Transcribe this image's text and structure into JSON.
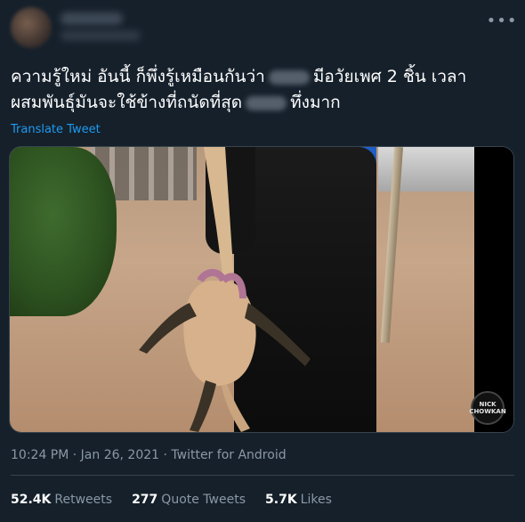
{
  "tweet": {
    "more_icon": "more-horizontal-icon",
    "text_line1_a": "ความรู้ใหม่ อันนี้ ก็พึ่งรู้เหมือนกันว่า",
    "text_line1_b": "มีอวัยเพศ 2 ชิ้น เวลา",
    "text_line2_a": "ผสมพันธุ์มันจะใช้ข้างที่ถนัดที่สุด",
    "text_line2_b": "ทึ่งมาก",
    "translate_label": "Translate Tweet",
    "timestamp": "10:24 PM · Jan 26, 2021 · Twitter for Android"
  },
  "media": {
    "watermark_line1": "NICK",
    "watermark_line2": "CHOWKAN"
  },
  "stats": {
    "retweets_count": "52.4K",
    "retweets_label": "Retweets",
    "quotes_count": "277",
    "quotes_label": "Quote Tweets",
    "likes_count": "5.7K",
    "likes_label": "Likes"
  },
  "colors": {
    "background": "#15202b",
    "link": "#1d9bf0",
    "secondary_text": "#8b98a5",
    "divider": "#38444d"
  }
}
